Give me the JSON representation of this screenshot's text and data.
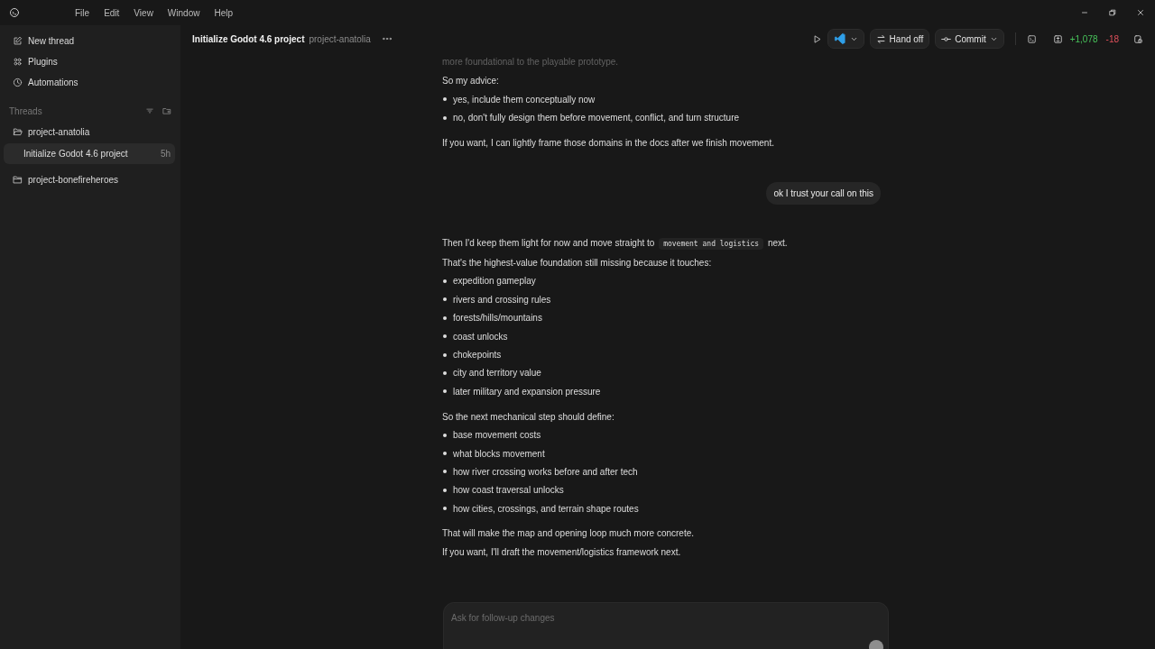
{
  "menu": [
    "File",
    "Edit",
    "View",
    "Window",
    "Help"
  ],
  "sidebar": {
    "nav": [
      {
        "kind": "new",
        "label": "New thread"
      },
      {
        "kind": "plugins",
        "label": "Plugins"
      },
      {
        "kind": "automations",
        "label": "Automations"
      }
    ],
    "threads_label": "Threads",
    "projects": [
      {
        "name": "project-anatolia",
        "expanded": true,
        "threads": [
          {
            "title": "Initialize Godot 4.6 project",
            "age": "5h",
            "selected": true
          }
        ]
      },
      {
        "name": "project-bonefireheroes",
        "expanded": false
      }
    ]
  },
  "header": {
    "title": "Initialize Godot 4.6 project",
    "project": "project-anatolia",
    "hand_off": "Hand off",
    "commit": "Commit",
    "additions": "+1,078",
    "deletions": "-18"
  },
  "conversation": [
    {
      "kind": "paragraph",
      "faded": true,
      "parts": [
        {
          "kind": "text",
          "text": "more foundational to the playable prototype."
        }
      ]
    },
    {
      "kind": "paragraph",
      "faded": false,
      "parts": [
        {
          "kind": "text",
          "text": "So my advice:"
        }
      ]
    },
    {
      "kind": "bullets",
      "items": [
        "yes, include them conceptually now",
        "no, don't fully design them before movement, conflict, and turn structure"
      ]
    },
    {
      "kind": "paragraph",
      "faded": false,
      "parts": [
        {
          "kind": "text",
          "text": "If you want, I can lightly frame those domains in the docs after we finish movement."
        }
      ]
    },
    {
      "kind": "user",
      "text": "ok I trust your call on this"
    },
    {
      "kind": "paragraph",
      "faded": false,
      "parts": [
        {
          "kind": "text",
          "text": "Then I'd keep them light for now and move straight to "
        },
        {
          "kind": "code",
          "text": "movement and logistics"
        },
        {
          "kind": "text",
          "text": " next."
        }
      ]
    },
    {
      "kind": "paragraph",
      "faded": false,
      "parts": [
        {
          "kind": "text",
          "text": "That's the highest-value foundation still missing because it touches:"
        }
      ]
    },
    {
      "kind": "bullets",
      "items": [
        "expedition gameplay",
        "rivers and crossing rules",
        "forests/hills/mountains",
        "coast unlocks",
        "chokepoints",
        "city and territory value",
        "later military and expansion pressure"
      ]
    },
    {
      "kind": "paragraph",
      "faded": false,
      "parts": [
        {
          "kind": "text",
          "text": "So the next mechanical step should define:"
        }
      ]
    },
    {
      "kind": "bullets",
      "items": [
        "base movement costs",
        "what blocks movement",
        "how river crossing works before and after tech",
        "how coast traversal unlocks",
        "how cities, crossings, and terrain shape routes"
      ]
    },
    {
      "kind": "paragraph",
      "faded": false,
      "parts": [
        {
          "kind": "text",
          "text": "That will make the map and opening loop much more concrete."
        }
      ]
    },
    {
      "kind": "paragraph",
      "faded": false,
      "parts": [
        {
          "kind": "text",
          "text": "If you want, I'll draft the movement/logistics framework next."
        }
      ]
    }
  ],
  "composer": {
    "placeholder": "Ask for follow-up changes"
  }
}
